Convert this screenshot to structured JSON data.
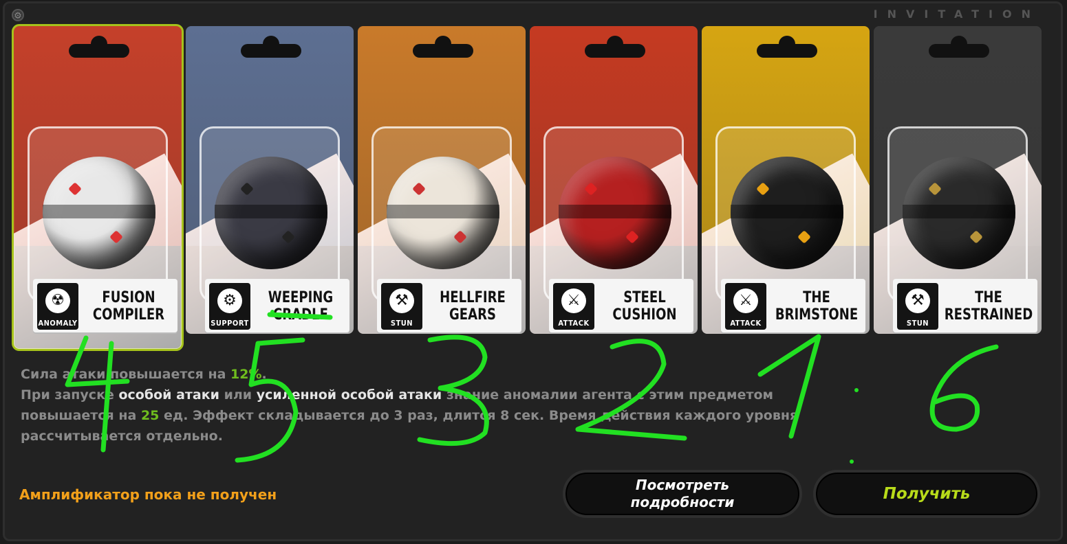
{
  "header": {
    "brand_text": "INVITATION",
    "corner_icon": "gear-icon"
  },
  "cards": [
    {
      "name": "FUSION\nCOMPILER",
      "role": "ANOMALY",
      "role_icon": "anomaly-icon",
      "role_glyph": "☢",
      "color": "#c5402a",
      "accent": "#d33",
      "ball": "#e8e8e8",
      "selected": true
    },
    {
      "name": "WEEPING\nCRADLE",
      "role": "SUPPORT",
      "role_icon": "support-icon",
      "role_glyph": "⚙",
      "color": "#5d6f92",
      "accent": "#222",
      "ball": "#3a3a44",
      "selected": false
    },
    {
      "name": "HELLFIRE\nGEARS",
      "role": "STUN",
      "role_icon": "stun-icon",
      "role_glyph": "⚒",
      "color": "#c97a2a",
      "accent": "#c33",
      "ball": "#ece5da",
      "selected": false
    },
    {
      "name": "STEEL\nCUSHION",
      "role": "ATTACK",
      "role_icon": "attack-icon",
      "role_glyph": "⚔",
      "color": "#c53a22",
      "accent": "#d22",
      "ball": "#b52020",
      "selected": false
    },
    {
      "name": "THE\nBRIMSTONE",
      "role": "ATTACK",
      "role_icon": "attack-icon",
      "role_glyph": "⚔",
      "color": "#d6a512",
      "accent": "#e8a012",
      "ball": "#1e1e1e",
      "selected": false
    },
    {
      "name": "THE\nRESTRAINED",
      "role": "STUN",
      "role_icon": "stun-icon",
      "role_glyph": "⚒",
      "color": "#3a3a3a",
      "accent": "#b8943a",
      "ball": "#2a2a2a",
      "selected": false
    }
  ],
  "description": {
    "line1_a": "Сила атаки повышается на ",
    "line1_b": "12%",
    "line1_c": ".",
    "line2_a": "При запуске ",
    "line2_b": "особой атаки",
    "line2_c": " или ",
    "line2_d": "усиленной особой атаки",
    "line2_e": " знание аномалии агента с этим предметом",
    "line3_a": "повышается на ",
    "line3_b": "25",
    "line3_c": " ед. Эффект складывается до 3 раз, длится 8 сек. Время действия каждого уровня",
    "line4": "рассчитывается отдельно."
  },
  "status_text": "Амплификатор пока не получен",
  "buttons": {
    "details": "Посмотреть\nподробности",
    "get": "Получить"
  },
  "annotations": [
    "4",
    "5",
    "3",
    "2",
    "1",
    "6"
  ],
  "colors": {
    "selected_outline": "#a6c21b",
    "highlight_green": "#6fbd1e",
    "status_orange": "#f2a01a",
    "get_button_text": "#b8db1a",
    "scribble": "#22e022"
  }
}
